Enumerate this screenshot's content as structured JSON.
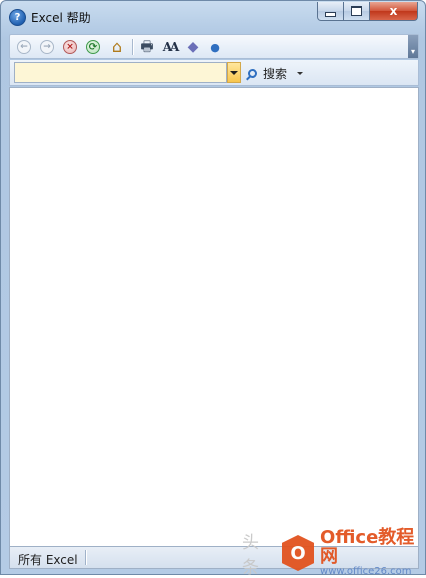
{
  "window": {
    "title": "Excel 帮助",
    "help_glyph": "?",
    "close_glyph": "x"
  },
  "toolbar": {
    "buttons": [
      {
        "name": "back-icon",
        "glyph": "←"
      },
      {
        "name": "forward-icon",
        "glyph": "→"
      },
      {
        "name": "stop-icon",
        "glyph": "×"
      },
      {
        "name": "refresh-icon",
        "glyph": "⟳"
      },
      {
        "name": "home-icon",
        "glyph": "⌂"
      },
      {
        "name": "print-icon",
        "glyph": "🖶"
      },
      {
        "name": "font-size-icon",
        "glyph": "AA"
      },
      {
        "name": "book-icon",
        "glyph": "◆"
      },
      {
        "name": "pushpin-icon",
        "glyph": "●"
      }
    ]
  },
  "search": {
    "value": "",
    "placeholder": "",
    "button_label": "搜索"
  },
  "status": {
    "scope": "所有 Excel"
  },
  "watermark": {
    "faint_text": "头条",
    "logo_glyph": "O",
    "brand": "Office教程网",
    "url": "www.office26.com"
  },
  "colors": {
    "accent": "#2f6fc0",
    "close": "#c8432a",
    "search_bg": "#fdf6d6",
    "brand": "#e2531f"
  }
}
